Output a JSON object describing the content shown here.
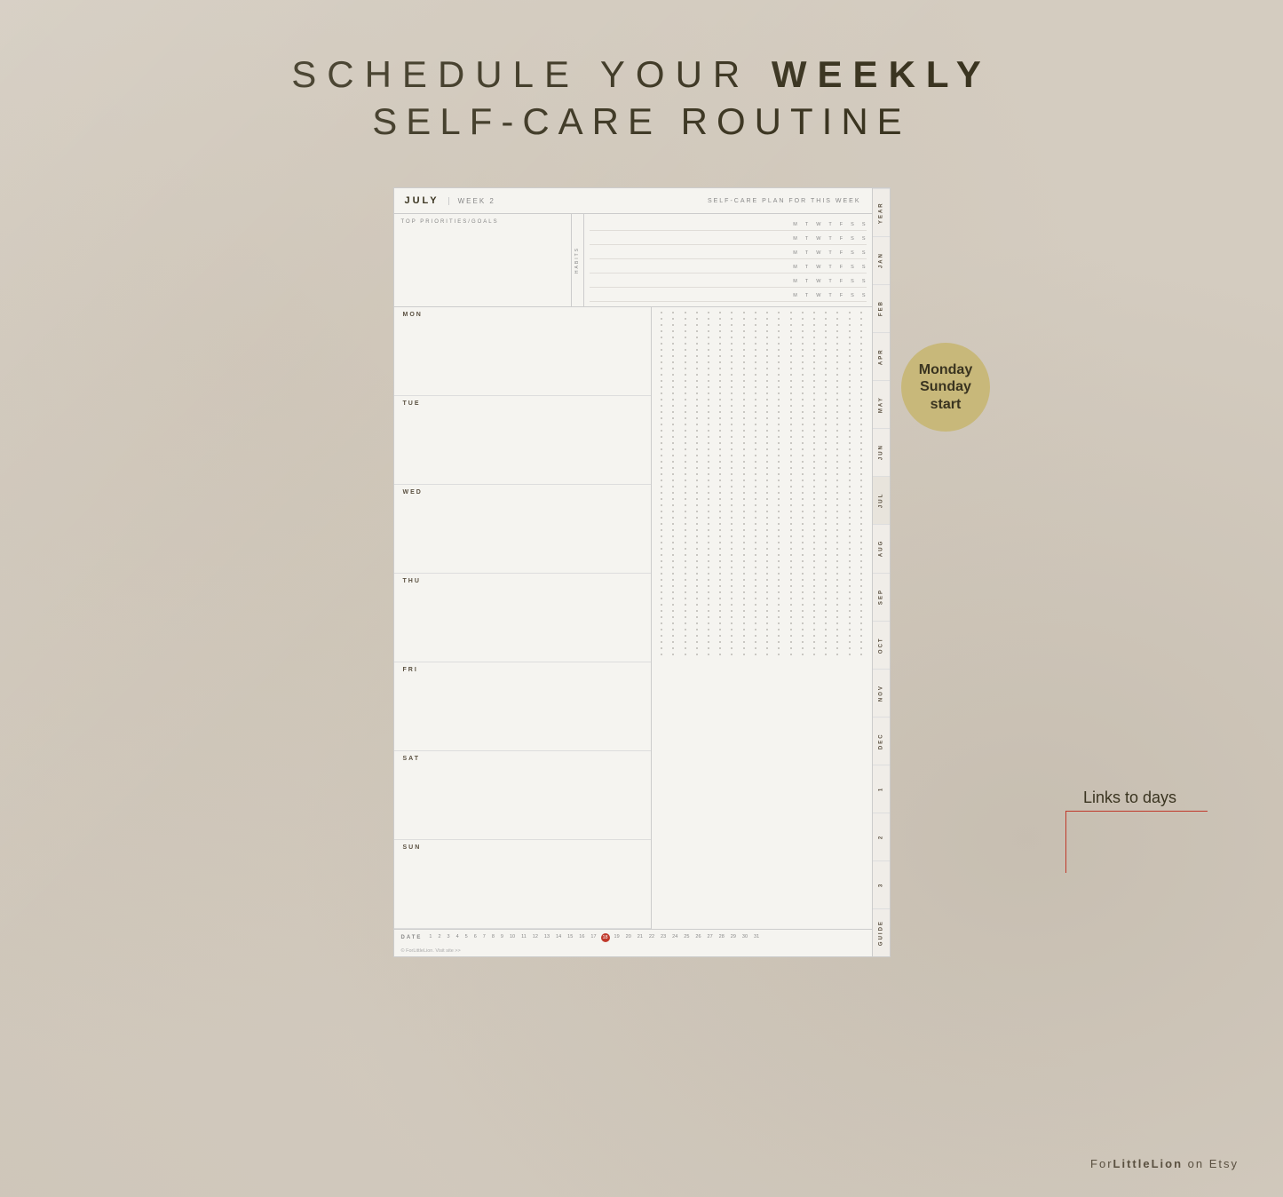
{
  "header": {
    "line1_normal": "SCHEDULE YOUR ",
    "line1_bold": "WEEKLY",
    "line2_bold": "SELF-CARE",
    "line2_normal": " ROUTINE"
  },
  "planner": {
    "month": "JULY",
    "week": "WEEK 2",
    "self_care_label": "SELF-CARE PLAN FOR THIS WEEK",
    "priorities_label": "TOP PRIORITIES/GOALS",
    "habits_label": "HABITS",
    "days_header": "M  T  W  T  F  S  S",
    "days": [
      {
        "label": "MON"
      },
      {
        "label": "TUE"
      },
      {
        "label": "WED"
      },
      {
        "label": "THU"
      },
      {
        "label": "FRI"
      },
      {
        "label": "SAT"
      },
      {
        "label": "SUN"
      }
    ],
    "month_tabs": [
      "YEAR",
      "JAN",
      "",
      "APR",
      "MAY",
      "JUN",
      "JUL",
      "AUG",
      "SEP",
      "OCT",
      "NOV",
      "DEC",
      "1",
      "2",
      "3",
      "GUIDE"
    ],
    "date_label": "DATE",
    "dates": [
      "1",
      "2",
      "3",
      "4",
      "5",
      "6",
      "7",
      "8",
      "9",
      "10",
      "11",
      "12",
      "13",
      "14",
      "15",
      "16",
      "17",
      "18",
      "19",
      "20",
      "21",
      "22",
      "23",
      "24",
      "25",
      "26",
      "27",
      "28",
      "29",
      "30",
      "31"
    ],
    "highlighted_date": "18",
    "footer": "© ForLittleLion.   Visit site >>"
  },
  "badge": {
    "line1": "Monday",
    "line2": "Sunday",
    "line3": "start"
  },
  "annotation": {
    "text": "Links to days"
  },
  "credit": {
    "prefix": "For",
    "brand": "LittleLion",
    "suffix": " on Etsy"
  }
}
